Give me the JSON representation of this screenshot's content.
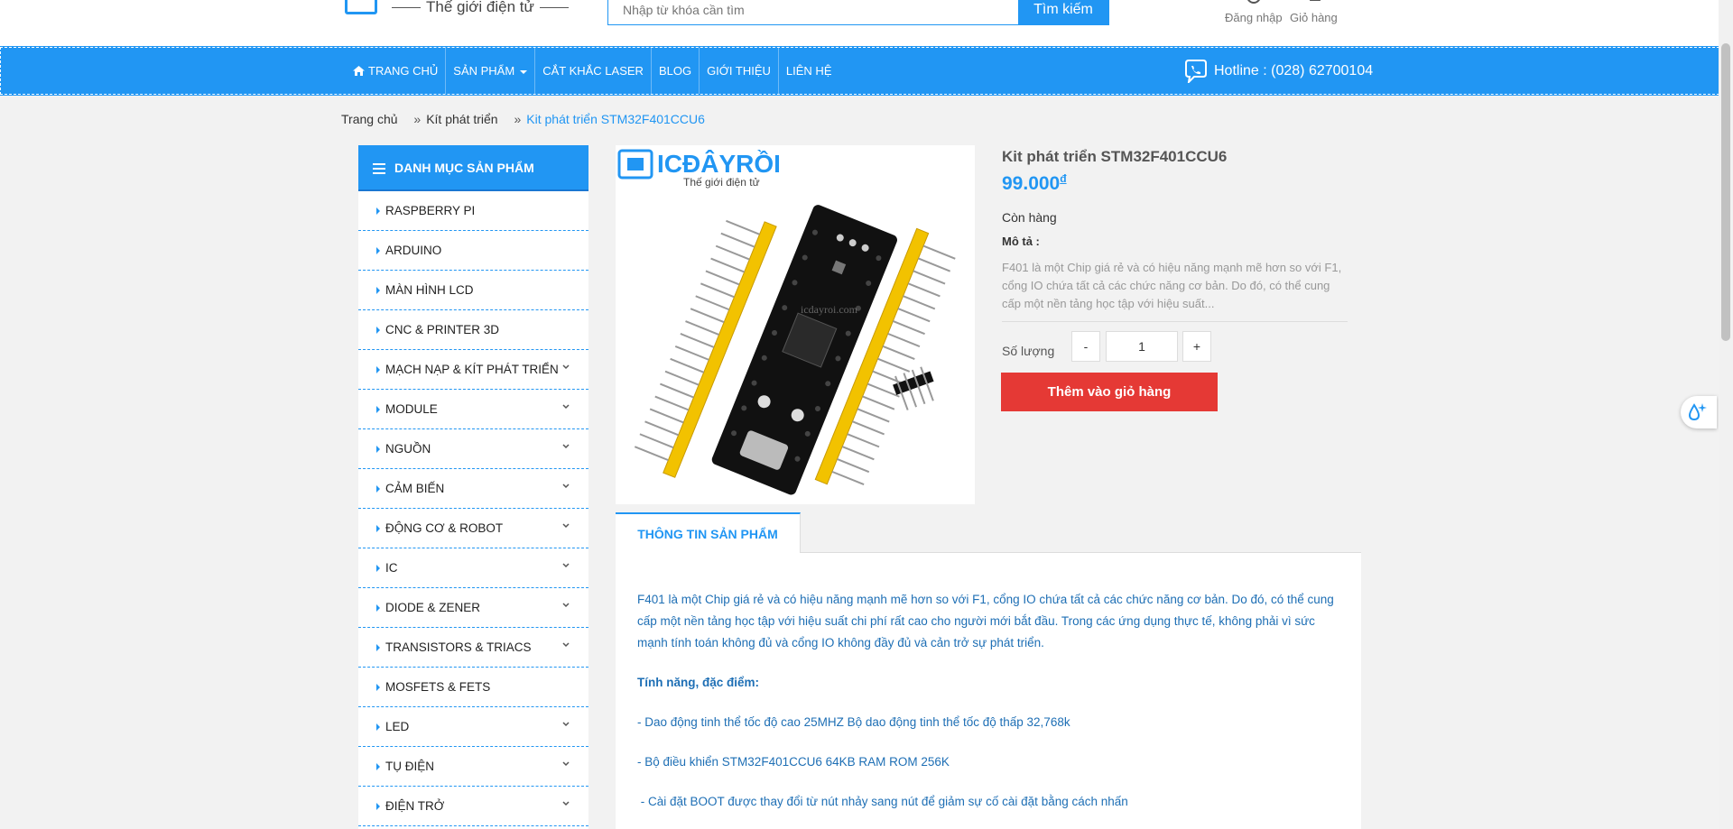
{
  "header": {
    "logo_tagline": "Thế giới điện tử",
    "search_placeholder": "Nhập từ khóa cần tìm",
    "search_button": "Tìm kiếm",
    "login_label": "Đăng nhập",
    "cart_label": "Giỏ hàng"
  },
  "nav": {
    "items": [
      {
        "label": "TRANG CHỦ"
      },
      {
        "label": "SẢN PHẨM"
      },
      {
        "label": "CẮT KHẮC LASER"
      },
      {
        "label": "BLOG"
      },
      {
        "label": "GIỚI THIỆU"
      },
      {
        "label": "LIÊN HỆ"
      }
    ],
    "hotline": "Hotline : (028) 62700104"
  },
  "breadcrumb": {
    "items": [
      "Trang chủ",
      "Kít phát triển",
      "Kit phát triển STM32F401CCU6"
    ]
  },
  "sidebar": {
    "title": "DANH MỤC SẢN PHẨM",
    "items": [
      {
        "label": "RASPBERRY PI"
      },
      {
        "label": "ARDUINO"
      },
      {
        "label": "MÀN HÌNH LCD"
      },
      {
        "label": "CNC & PRINTER 3D"
      },
      {
        "label": "MẠCH NẠP & KÍT PHÁT TRIỂN"
      },
      {
        "label": "MODULE"
      },
      {
        "label": "NGUỒN"
      },
      {
        "label": "CẢM BIẾN"
      },
      {
        "label": "ĐỘNG CƠ & ROBOT"
      },
      {
        "label": "IC"
      },
      {
        "label": "DIODE & ZENER"
      },
      {
        "label": "TRANSISTORS & TRIACS"
      },
      {
        "label": "MOSFETS & FETS"
      },
      {
        "label": "LED"
      },
      {
        "label": "TỤ ĐIỆN"
      },
      {
        "label": "ĐIỆN TRỞ"
      }
    ]
  },
  "product": {
    "image_logo": "ICĐÂYRỒI",
    "image_tagline": "Thế giới điện tử",
    "watermark": "icdayroi.com",
    "title": "Kit phát triển STM32F401CCU6",
    "price": "99.000",
    "currency": "đ",
    "stock": "Còn hàng",
    "desc_label": "Mô tả :",
    "description": "F401 là một Chip giá rẻ và có hiệu năng mạnh mẽ hơn so với F1, cổng IO chứa tất cả các chức năng cơ bản. Do đó, có thể cung cấp một nền tảng học tập với hiệu suất...",
    "qty_label": "Số lượng",
    "qty_minus": "-",
    "qty_value": "1",
    "qty_plus": "+",
    "add_to_cart": "Thêm vào giỏ hàng"
  },
  "info": {
    "tab_label": "THÔNG TIN SẢN PHẨM",
    "intro": "F401 là một Chip giá rẻ và có hiệu năng mạnh mẽ hơn so với F1, cổng IO chứa tất cả các chức năng cơ bản. Do đó, có thể cung cấp một nền tảng học tập với hiệu suất chi phí rất cao cho người mới bắt đầu. Trong các ứng dụng thực tế, không phải vì sức mạnh tính toán không đủ và cổng IO không đầy đủ và cản trở sự phát triển.",
    "features_heading": "Tính năng, đặc điểm:",
    "features": [
      "- Dao động tinh thể tốc độ cao 25MHZ Bộ dao động tinh thể tốc độ thấp 32,768k",
      "- Bộ điều khiển STM32F401CCU6 64KB RAM ROM 256K",
      " - Cài đặt BOOT được thay đổi từ nút nhảy sang nút để giảm sự cố cài đặt bằng cách nhấn"
    ]
  },
  "colors": {
    "primary": "#2196f3",
    "add_to_cart": "#e53935",
    "background": "#f2f2f2"
  }
}
